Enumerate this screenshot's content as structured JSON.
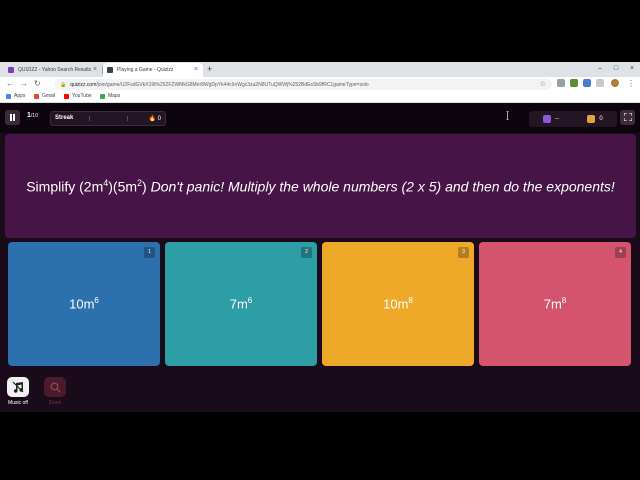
{
  "browser": {
    "tabs": [
      {
        "title": "QUIZIZZ - Yahoo Search Results",
        "active": false,
        "favicon_color": "#7b3fc1"
      },
      {
        "title": "Playing a Game - Quizizz",
        "active": true,
        "favicon_color": "#3c4043"
      }
    ],
    "new_tab_icon": "plus-icon",
    "address": {
      "host": "quizizz.com",
      "path": "/join/game/U2FsdGVkX19t%252FZWMkG8Mnr8WgDpYk44c9nWgc3za2N8UTuQWWj%252BdEsSb9fRC1gameType=solo"
    },
    "bookmarks": [
      {
        "label": "Apps",
        "icon": "apps-grid-icon",
        "color": "#4285f4"
      },
      {
        "label": "Gmail",
        "icon": "gmail-icon",
        "color": "#ea4335"
      },
      {
        "label": "YouTube",
        "icon": "youtube-icon",
        "color": "#ff0000"
      },
      {
        "label": "Maps",
        "icon": "maps-icon",
        "color": "#34a853"
      }
    ]
  },
  "game": {
    "progress": {
      "current": "1",
      "total": "/10"
    },
    "streak": {
      "label": "Streak",
      "value": "0"
    },
    "powerups": {
      "left_value": "--",
      "right_value": "0"
    },
    "question": {
      "prefix": "Simplify (2m",
      "exp1": "4",
      "middle": ")(5m",
      "exp2": "2",
      "close": ")",
      "hint": "Don't panic! Multiply the whole numbers (2 x 5) and then do the exponents!"
    },
    "answers": [
      {
        "number": "1",
        "base": "10m",
        "exp": "6",
        "color": "#2d70ae"
      },
      {
        "number": "2",
        "base": "7m",
        "exp": "6",
        "color": "#2d9da6"
      },
      {
        "number": "3",
        "base": "10m",
        "exp": "8",
        "color": "#efa929"
      },
      {
        "number": "4",
        "base": "7m",
        "exp": "8",
        "color": "#d5546d"
      }
    ],
    "bottom": {
      "music_label": "Music off",
      "zoom_label": "Zoom"
    }
  }
}
